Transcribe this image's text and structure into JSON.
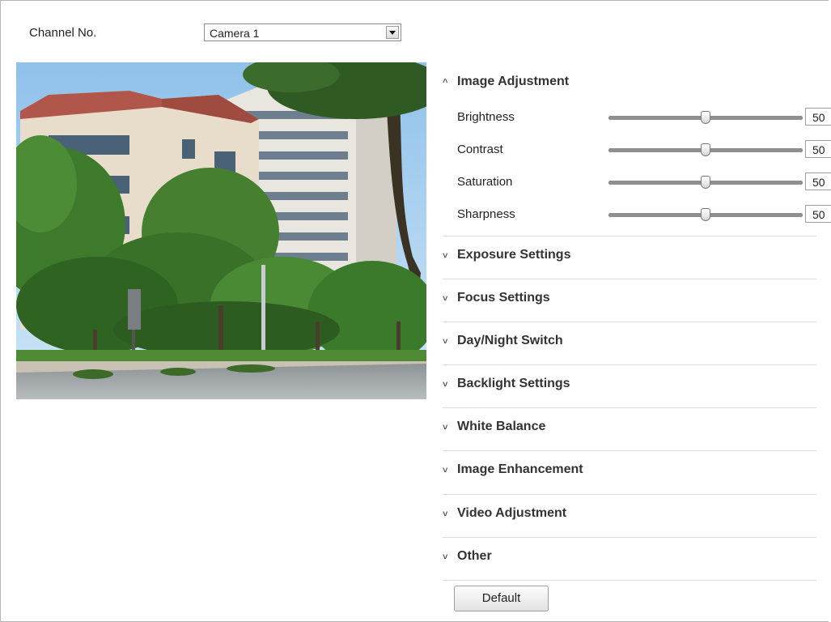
{
  "channel": {
    "label": "Channel No.",
    "selected": "Camera 1"
  },
  "preview": {
    "scene": "live camera view of apartment buildings, trees and street"
  },
  "panel": {
    "expanded_section": {
      "title": "Image Adjustment",
      "chevron": "^",
      "sliders": [
        {
          "label": "Brightness",
          "value": "50",
          "level": 0.5
        },
        {
          "label": "Contrast",
          "value": "50",
          "level": 0.5
        },
        {
          "label": "Saturation",
          "value": "50",
          "level": 0.5
        },
        {
          "label": "Sharpness",
          "value": "50",
          "level": 0.5
        }
      ]
    },
    "collapsed_sections": [
      {
        "title": "Exposure Settings",
        "chevron": "˅"
      },
      {
        "title": "Focus Settings",
        "chevron": "˅"
      },
      {
        "title": "Day/Night Switch",
        "chevron": "˅"
      },
      {
        "title": "Backlight Settings",
        "chevron": "˅"
      },
      {
        "title": "White Balance",
        "chevron": "˅"
      },
      {
        "title": "Image Enhancement",
        "chevron": "˅"
      },
      {
        "title": "Video Adjustment",
        "chevron": "˅"
      },
      {
        "title": "Other",
        "chevron": "˅"
      }
    ],
    "default_button": "Default"
  }
}
